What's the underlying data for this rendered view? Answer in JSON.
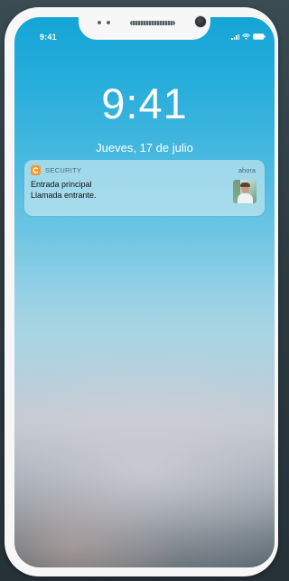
{
  "status_bar": {
    "time": "9:41",
    "signal_icon": "cellular-signal-icon",
    "wifi_icon": "wifi-icon",
    "battery_icon": "battery-icon"
  },
  "lock_screen": {
    "time": "9:41",
    "date": "Jueves, 17 de julio"
  },
  "notification": {
    "app_icon": "security-app-icon",
    "app_icon_color": "#f29a2e",
    "app_name": "SECURITY",
    "time": "ahora",
    "title": "Entrada principal",
    "body": "Llamada entrante.",
    "thumbnail": "visitor-photo"
  },
  "colors": {
    "frame": "#f7f7f8",
    "wallpaper_top": "#14a5d6",
    "wallpaper_bottom": "#606b72",
    "text_on_wallpaper": "#ffffff"
  }
}
